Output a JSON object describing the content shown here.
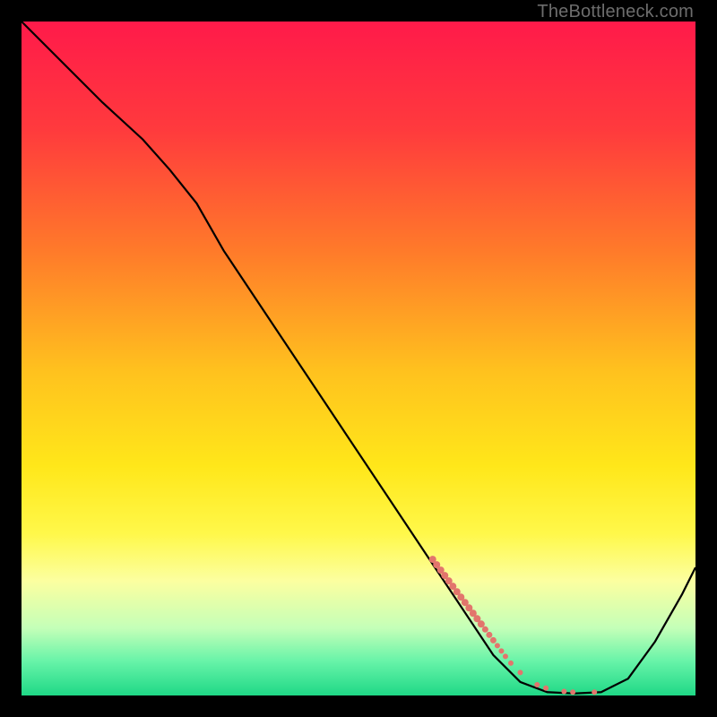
{
  "watermark": "TheBottleneck.com",
  "chart_data": {
    "type": "line",
    "title": "",
    "xlabel": "",
    "ylabel": "",
    "xlim": [
      0,
      100
    ],
    "ylim": [
      0,
      100
    ],
    "grid": false,
    "gradient_stops": [
      {
        "offset": 0.0,
        "color": "#ff1a4a"
      },
      {
        "offset": 0.16,
        "color": "#ff3a3d"
      },
      {
        "offset": 0.34,
        "color": "#ff7a2a"
      },
      {
        "offset": 0.52,
        "color": "#ffc21e"
      },
      {
        "offset": 0.66,
        "color": "#ffe71a"
      },
      {
        "offset": 0.76,
        "color": "#fff84a"
      },
      {
        "offset": 0.83,
        "color": "#fcffa0"
      },
      {
        "offset": 0.9,
        "color": "#c4ffb8"
      },
      {
        "offset": 0.95,
        "color": "#66f3a8"
      },
      {
        "offset": 1.0,
        "color": "#1fd886"
      }
    ],
    "series": [
      {
        "name": "bottleneck-curve",
        "color": "#000000",
        "x": [
          0,
          6,
          12,
          18,
          22,
          26,
          30,
          36,
          42,
          48,
          54,
          60,
          66,
          70,
          74,
          78,
          82,
          86,
          90,
          94,
          98,
          100
        ],
        "y": [
          100,
          94,
          88,
          82.5,
          78,
          73,
          66,
          57,
          48,
          39,
          30,
          21,
          12,
          6,
          2,
          0.5,
          0.3,
          0.5,
          2.5,
          8,
          15,
          19
        ]
      }
    ],
    "markers": {
      "name": "highlight-points",
      "color": "#e2756c",
      "points": [
        {
          "x": 61.0,
          "y": 20.2,
          "r": 4
        },
        {
          "x": 61.6,
          "y": 19.4,
          "r": 4
        },
        {
          "x": 62.2,
          "y": 18.6,
          "r": 4
        },
        {
          "x": 62.8,
          "y": 17.8,
          "r": 4
        },
        {
          "x": 63.4,
          "y": 17.0,
          "r": 4
        },
        {
          "x": 64.0,
          "y": 16.2,
          "r": 4
        },
        {
          "x": 64.6,
          "y": 15.4,
          "r": 4
        },
        {
          "x": 65.2,
          "y": 14.6,
          "r": 4
        },
        {
          "x": 65.8,
          "y": 13.8,
          "r": 4
        },
        {
          "x": 66.4,
          "y": 13.0,
          "r": 4
        },
        {
          "x": 67.0,
          "y": 12.2,
          "r": 4
        },
        {
          "x": 67.6,
          "y": 11.4,
          "r": 4
        },
        {
          "x": 68.2,
          "y": 10.6,
          "r": 4
        },
        {
          "x": 68.8,
          "y": 9.8,
          "r": 3.5
        },
        {
          "x": 69.4,
          "y": 9.0,
          "r": 3.5
        },
        {
          "x": 70.0,
          "y": 8.2,
          "r": 3.5
        },
        {
          "x": 70.6,
          "y": 7.4,
          "r": 3
        },
        {
          "x": 71.2,
          "y": 6.6,
          "r": 3
        },
        {
          "x": 71.8,
          "y": 5.8,
          "r": 3
        },
        {
          "x": 72.6,
          "y": 4.8,
          "r": 3
        },
        {
          "x": 74.0,
          "y": 3.4,
          "r": 3
        },
        {
          "x": 76.5,
          "y": 1.6,
          "r": 3
        },
        {
          "x": 77.8,
          "y": 1.1,
          "r": 3
        },
        {
          "x": 80.5,
          "y": 0.6,
          "r": 3
        },
        {
          "x": 81.8,
          "y": 0.5,
          "r": 3
        },
        {
          "x": 85.0,
          "y": 0.5,
          "r": 3
        }
      ]
    }
  }
}
